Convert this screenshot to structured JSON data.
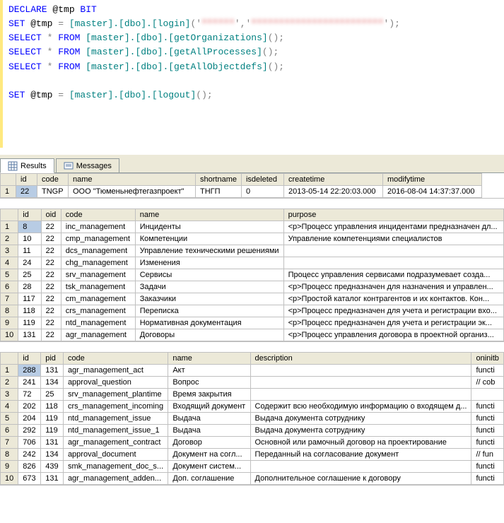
{
  "sql": {
    "line1": {
      "kw1": "DECLARE",
      "var": " @tmp ",
      "ty": "BIT"
    },
    "line2": {
      "kw1": "SET",
      "var": " @tmp ",
      "eq": "=",
      "obj": " [master].[dbo].[login]",
      "gray": "('",
      "str1": "******",
      "comma": "','",
      "str2": "************************",
      "end": "');"
    },
    "line3": {
      "kw1": "SELECT",
      "star": " * ",
      "kw2": "FROM",
      "obj": " [master].[dbo].[getOrganizations]",
      "gray": "();"
    },
    "line4": {
      "kw1": "SELECT",
      "star": " * ",
      "kw2": "FROM",
      "obj": " [master].[dbo].[getAllProcesses]",
      "gray": "();"
    },
    "line5": {
      "kw1": "SELECT",
      "star": " * ",
      "kw2": "FROM",
      "obj": " [master].[dbo].[getAllObjectdefs]",
      "gray": "();"
    },
    "line6": {
      "kw1": "SET",
      "var": " @tmp ",
      "eq": "=",
      "obj": " [master].[dbo].[logout]",
      "gray": "();"
    }
  },
  "tabs": {
    "results": "Results",
    "messages": "Messages"
  },
  "grid1": {
    "headers": {
      "id": "id",
      "code": "code",
      "name": "name",
      "shortname": "shortname",
      "isdeleted": "isdeleted",
      "createtime": "createtime",
      "modifytime": "modifytime"
    },
    "rows": [
      {
        "n": "1",
        "id": "22",
        "code": "TNGP",
        "name": "ООО \"Тюменьнефтегазпроект\"",
        "shortname": "ТНГП",
        "isdeleted": "0",
        "createtime": "2013-05-14 22:20:03.000",
        "modifytime": "2016-08-04 14:37:37.000"
      }
    ]
  },
  "grid2": {
    "headers": {
      "id": "id",
      "oid": "oid",
      "code": "code",
      "name": "name",
      "purpose": "purpose"
    },
    "rows": [
      {
        "n": "1",
        "id": "8",
        "oid": "22",
        "code": "inc_management",
        "name": "Инциденты",
        "purpose": "<p>Процесс управления инцидентами предназначен дл..."
      },
      {
        "n": "2",
        "id": "10",
        "oid": "22",
        "code": "cmp_management",
        "name": "Компетенции",
        "purpose": "Управление компетенциями специалистов"
      },
      {
        "n": "3",
        "id": "11",
        "oid": "22",
        "code": "dcs_management",
        "name": "Управление техническими решениями",
        "purpose": ""
      },
      {
        "n": "4",
        "id": "24",
        "oid": "22",
        "code": "chg_management",
        "name": "Изменения",
        "purpose": ""
      },
      {
        "n": "5",
        "id": "25",
        "oid": "22",
        "code": "srv_management",
        "name": "Сервисы",
        "purpose": "Процесс управления сервисами подразумевает созда..."
      },
      {
        "n": "6",
        "id": "28",
        "oid": "22",
        "code": "tsk_management",
        "name": "Задачи",
        "purpose": "<p>Процесс предназначен для назначения и управлен..."
      },
      {
        "n": "7",
        "id": "117",
        "oid": "22",
        "code": "cm_management",
        "name": "Заказчики",
        "purpose": "<p>Простой каталог контрагентов и их контактов. Кон..."
      },
      {
        "n": "8",
        "id": "118",
        "oid": "22",
        "code": "crs_management",
        "name": "Переписка",
        "purpose": "<p>Процесс предназначен для учета и регистрации вхо..."
      },
      {
        "n": "9",
        "id": "119",
        "oid": "22",
        "code": "ntd_management",
        "name": "Нормативная документация",
        "purpose": "<p>Процесс предназначен для учета и регистрации эк..."
      },
      {
        "n": "10",
        "id": "131",
        "oid": "22",
        "code": "agr_management",
        "name": "Договоры",
        "purpose": "<p>Процесс управления договора в проектной организ..."
      }
    ]
  },
  "grid3": {
    "headers": {
      "id": "id",
      "pid": "pid",
      "code": "code",
      "name": "name",
      "description": "description",
      "oninit": "oninitb"
    },
    "rows": [
      {
        "n": "1",
        "id": "288",
        "pid": "131",
        "code": "agr_management_act",
        "name": "Акт",
        "description": "",
        "oninit": "functi"
      },
      {
        "n": "2",
        "id": "241",
        "pid": "134",
        "code": "approval_question",
        "name": "Вопрос",
        "description": "",
        "oninit": "// cob"
      },
      {
        "n": "3",
        "id": "72",
        "pid": "25",
        "code": "srv_management_plantime",
        "name": "Время закрытия",
        "description": "",
        "oninit": ""
      },
      {
        "n": "4",
        "id": "202",
        "pid": "118",
        "code": "crs_management_incoming",
        "name": "Входящий документ",
        "description": "Содержит всю необходимую информацию о входящем д...",
        "oninit": "functi"
      },
      {
        "n": "5",
        "id": "204",
        "pid": "119",
        "code": "ntd_management_issue",
        "name": "Выдача",
        "description": "Выдача документа сотруднику",
        "oninit": "functi"
      },
      {
        "n": "6",
        "id": "292",
        "pid": "119",
        "code": "ntd_management_issue_1",
        "name": "Выдача",
        "description": "Выдача документа сотруднику",
        "oninit": "functi"
      },
      {
        "n": "7",
        "id": "706",
        "pid": "131",
        "code": "agr_management_contract",
        "name": "Договор",
        "description": "Основной или рамочный договор на проектирование",
        "oninit": "functi"
      },
      {
        "n": "8",
        "id": "242",
        "pid": "134",
        "code": "approval_document",
        "name": "Документ на согл...",
        "description": "Переданный на согласование документ",
        "oninit": "// fun"
      },
      {
        "n": "9",
        "id": "826",
        "pid": "439",
        "code": "smk_management_doc_s...",
        "name": "Документ систем...",
        "description": "",
        "oninit": "functi"
      },
      {
        "n": "10",
        "id": "673",
        "pid": "131",
        "code": "agr_management_adden...",
        "name": "Доп. соглашение",
        "description": "Дополнительное соглашение к договору",
        "oninit": "functi"
      }
    ]
  }
}
